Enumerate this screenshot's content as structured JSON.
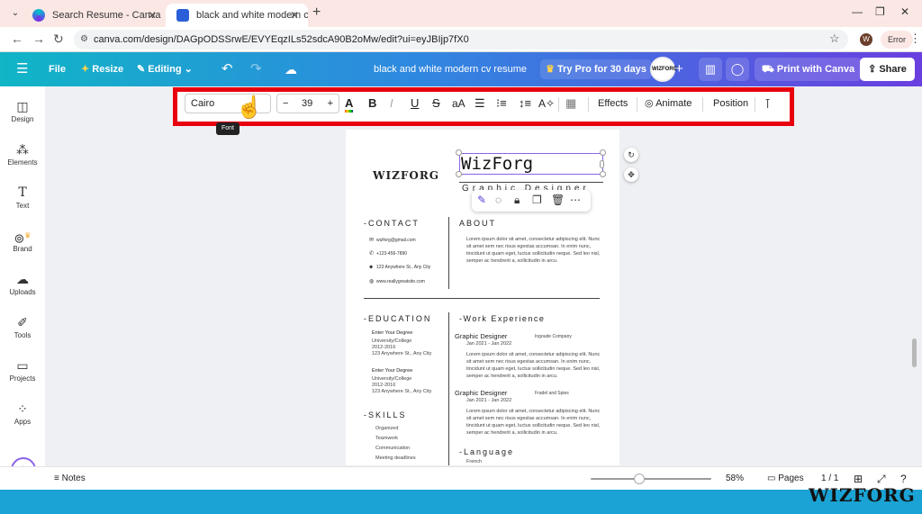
{
  "browser": {
    "tabs": [
      {
        "title": "Search Resume - Canva",
        "active": false
      },
      {
        "title": "black and white modern cv resu",
        "active": true
      }
    ],
    "url": "canva.com/design/DAGpODSSrwE/EVYEqzILs52sdcA90B2oMw/edit?ui=eyJBIjp7fX0",
    "profile_initial": "W",
    "error_label": "Error"
  },
  "canva_header": {
    "file": "File",
    "resize": "Resize",
    "editing": "Editing",
    "design_title": "black and white modern cv resume",
    "try_pro": "Try Pro for 30 days",
    "avatar_text": "WIZFORG",
    "print": "Print with Canva",
    "share": "Share"
  },
  "sidebar": [
    {
      "label": "Design",
      "icon": "design-icon"
    },
    {
      "label": "Elements",
      "icon": "elements-icon"
    },
    {
      "label": "Text",
      "icon": "text-icon"
    },
    {
      "label": "Brand",
      "icon": "brand-icon"
    },
    {
      "label": "Uploads",
      "icon": "uploads-icon"
    },
    {
      "label": "Tools",
      "icon": "tools-icon"
    },
    {
      "label": "Projects",
      "icon": "projects-icon"
    },
    {
      "label": "Apps",
      "icon": "apps-icon"
    }
  ],
  "toolbar": {
    "font": "Cairo",
    "size_minus": "−",
    "font_size": "39",
    "size_plus": "+",
    "effects": "Effects",
    "animate": "Animate",
    "position": "Position",
    "tooltip": "Font"
  },
  "resume": {
    "logo": "WIZFORG",
    "name": "WizForg",
    "role": "Graphic Designer",
    "sections": {
      "contact": "-CONTACT",
      "about": "ABOUT",
      "education": "-EDUCATION",
      "work": "-Work Experience",
      "skills": "-SKILLS",
      "language": "-Language"
    },
    "contact": [
      {
        "icon": "mail-icon",
        "text": "wizforg@gmail.com"
      },
      {
        "icon": "phone-icon",
        "text": "+123-456-7890"
      },
      {
        "icon": "location-icon",
        "text": "123 Anywhere St., Any City"
      },
      {
        "icon": "web-icon",
        "text": "www.reallygreatsite.com"
      }
    ],
    "about_text": "Lorem ipsum dolor sit amet, consectetur adipiscing elit. Nunc sit amet sem nec risus egestas accumsan. In enim nunc, tincidunt ut quam eget, luctus sollicitudin neque. Sed leo nisl, semper ac hendrerit a, sollicitudin in arcu.",
    "education": [
      {
        "degree": "Enter Your Degree",
        "school": "University/College",
        "years": "2012-2016",
        "address": "123 Anywhere St., Any City"
      },
      {
        "degree": "Enter Your Degree",
        "school": "University/College",
        "years": "2012-2016",
        "address": "123 Anywhere St., Any City"
      }
    ],
    "jobs": [
      {
        "title": "Graphic Designer",
        "company": "Ingoude Company",
        "dates": "Jan 2021 - Jan 2022",
        "text": "Lorem ipsum dolor sit amet, consectetur adipiscing elit. Nunc sit amet sem nec risus egestas accumsan. In enim nunc, tincidunt ut quam eget, luctus sollicitudin neque. Sed leo nisl, semper ac hendrerit a, sollicitudin in arcu."
      },
      {
        "title": "Graphic Designer",
        "company": "Fradel and Spies",
        "dates": "Jan 2021 - Jan 2022",
        "text": "Lorem ipsum dolor sit amet, consectetur adipiscing elit. Nunc sit amet sem nec risus egestas accumsan. In enim nunc, tincidunt ut quam eget, luctus sollicitudin neque. Sed leo nisl, semper ac hendrerit a, sollicitudin in arcu."
      }
    ],
    "skills": [
      "Organized",
      "Teamwork",
      "Communication",
      "Meeting deadlines"
    ],
    "languages": [
      "French"
    ]
  },
  "bottom": {
    "notes": "Notes",
    "zoom_percent": 58,
    "zoom": "58%",
    "pages": "Pages",
    "page_count": "1 / 1"
  },
  "watermark": "WIZFORG",
  "colors": {
    "highlight": "#e8000e",
    "canva_gradient_start": "#10b5c6",
    "canva_gradient_end": "#6a3fe0",
    "selection": "#8a63e8",
    "taskbar": "#1aa3d4"
  }
}
